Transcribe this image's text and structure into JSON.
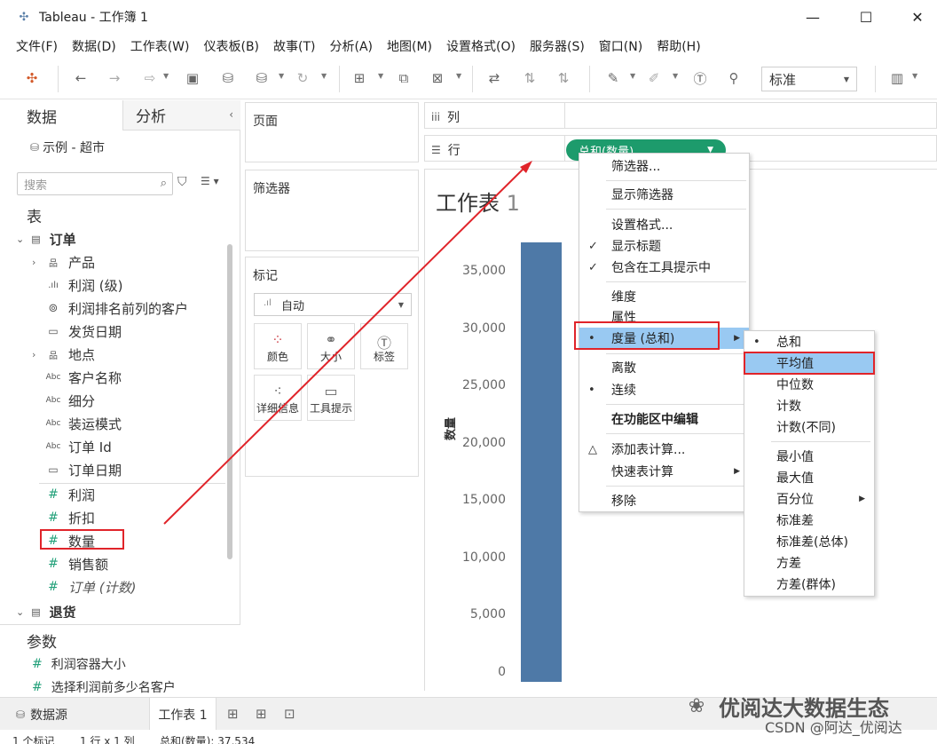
{
  "window": {
    "title": "Tableau - 工作簿 1",
    "minimize_glyph": "—",
    "maximize_glyph": "☐",
    "close_glyph": "✕"
  },
  "menu": [
    "文件(F)",
    "数据(D)",
    "工作表(W)",
    "仪表板(B)",
    "故事(T)",
    "分析(A)",
    "地图(M)",
    "设置格式(O)",
    "服务器(S)",
    "窗口(N)",
    "帮助(H)"
  ],
  "toolbar": {
    "fit_select": "标准"
  },
  "left_panel": {
    "tab_data": "数据",
    "tab_analysis": "分析",
    "datasource": "示例 - 超市",
    "search_placeholder": "搜索",
    "tables_title": "表",
    "orders_table": "订单",
    "returns_table": "退货",
    "fields": [
      {
        "label": "产品",
        "icon": "hierarchy-icon",
        "expander": true
      },
      {
        "label": "利润 (级)",
        "icon": "bin-icon"
      },
      {
        "label": "利润排名前列的客户",
        "icon": "set-icon"
      },
      {
        "label": "发货日期",
        "icon": "calendar-icon"
      },
      {
        "label": "地点",
        "icon": "hierarchy-icon",
        "expander": true
      },
      {
        "label": "客户名称",
        "icon": "abc-icon"
      },
      {
        "label": "细分",
        "icon": "abc-icon"
      },
      {
        "label": "装运模式",
        "icon": "abc-icon"
      },
      {
        "label": "订单 Id",
        "icon": "abc-icon"
      },
      {
        "label": "订单日期",
        "icon": "calendar-icon"
      },
      {
        "label": "利润",
        "icon": "measure-icon"
      },
      {
        "label": "折扣",
        "icon": "measure-icon"
      },
      {
        "label": "数量",
        "icon": "measure-icon"
      },
      {
        "label": "销售额",
        "icon": "measure-icon"
      },
      {
        "label": "订单 (计数)",
        "icon": "measure-icon",
        "italic": true
      }
    ],
    "params_title": "参数",
    "params": [
      "利润容器大小",
      "选择利润前多少名客户"
    ]
  },
  "shelves": {
    "pages": "页面",
    "filters": "筛选器",
    "marks": "标记",
    "mark_type": "自动",
    "mark_buttons": [
      "颜色",
      "大小",
      "标签",
      "详细信息",
      "工具提示"
    ],
    "columns": "列",
    "rows": "行",
    "row_pill": "总和(数量)"
  },
  "sheet": {
    "title": "工作表",
    "title_num": "1"
  },
  "chart_data": {
    "type": "bar",
    "categories": [
      ""
    ],
    "values": [
      37534
    ],
    "ylabel": "数量",
    "ylim": [
      0,
      37534
    ],
    "yticks": [
      "35,000",
      "30,000",
      "25,000",
      "20,000",
      "15,000",
      "10,000",
      "5,000",
      "0"
    ],
    "ytick_values": [
      35000,
      30000,
      25000,
      20000,
      15000,
      10000,
      5000,
      0
    ],
    "bar_color": "#4e79a7"
  },
  "context_menu": {
    "items": [
      "筛选器...",
      "显示筛选器",
      "设置格式...",
      "显示标题",
      "包含在工具提示中",
      "维度",
      "属性",
      "度量 (总和)",
      "离散",
      "连续",
      "在功能区中编辑",
      "添加表计算...",
      "快速表计算",
      "移除"
    ],
    "submenu": [
      "总和",
      "平均值",
      "中位数",
      "计数",
      "计数(不同)",
      "最小值",
      "最大值",
      "百分位",
      "标准差",
      "标准差(总体)",
      "方差",
      "方差(群体)"
    ]
  },
  "bottom": {
    "datasource_tab": "数据源",
    "sheet_tab": "工作表 1",
    "status": [
      "1 个标记",
      "1 行 x 1 列",
      "总和(数量): 37,534"
    ]
  },
  "watermark": {
    "text": "优阅达大数据生态",
    "csdn": "CSDN @阿达_优阅达"
  },
  "colors": {
    "accent_green": "#1d9b6c",
    "highlight_blue": "#99c9f2",
    "annotation_red": "#e0242a"
  }
}
